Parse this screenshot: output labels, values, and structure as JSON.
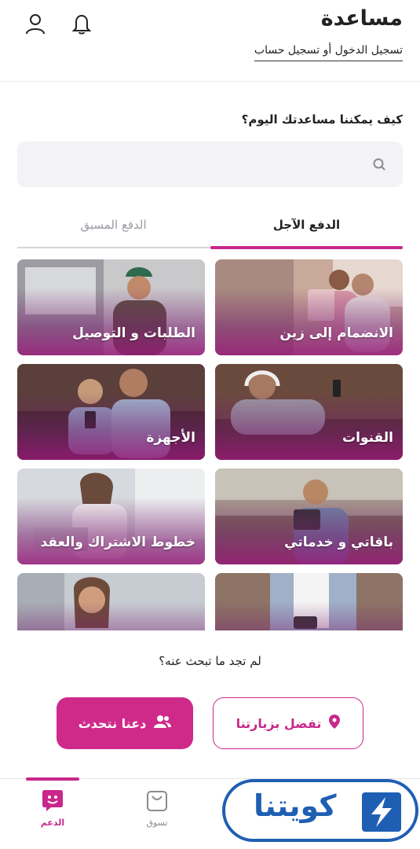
{
  "header": {
    "title": "مساعدة",
    "login_link": "تسجيل الدخول أو تسجيل حساب"
  },
  "help": {
    "question": "كيف يمكننا مساعدتك اليوم؟",
    "search_placeholder": ""
  },
  "tabs": [
    {
      "label": "الدفع الآجل",
      "active": true
    },
    {
      "label": "الدفع المسبق",
      "active": false
    }
  ],
  "cards": [
    {
      "label": "الانضمام إلى زين",
      "icon": "family-photo"
    },
    {
      "label": "الطلبات و التوصيل",
      "icon": "delivery-photo"
    },
    {
      "label": "القنوات",
      "icon": "couch-headphones-photo"
    },
    {
      "label": "الأجهزة",
      "icon": "father-son-phone-photo"
    },
    {
      "label": "باقاتي و خدماتي",
      "icon": "tablet-man-photo"
    },
    {
      "label": "خطوط الاشتراك والعقد",
      "icon": "woman-laptop-photo"
    },
    {
      "label": "",
      "icon": "man-phone-photo"
    },
    {
      "label": "",
      "icon": "woman-call-photo"
    }
  ],
  "footer_help": {
    "not_found": "لم تجد ما تبحث عنه؟",
    "visit_button": "تفضل بزيارتنا",
    "chat_button": "دعنا نتحدث"
  },
  "bottom_nav": {
    "support": "الدعم",
    "shop": "تسوق"
  },
  "watermark": {
    "text": "كويتنا"
  },
  "colors": {
    "accent": "#c8288b",
    "watermark_blue": "#1f5fb3"
  }
}
